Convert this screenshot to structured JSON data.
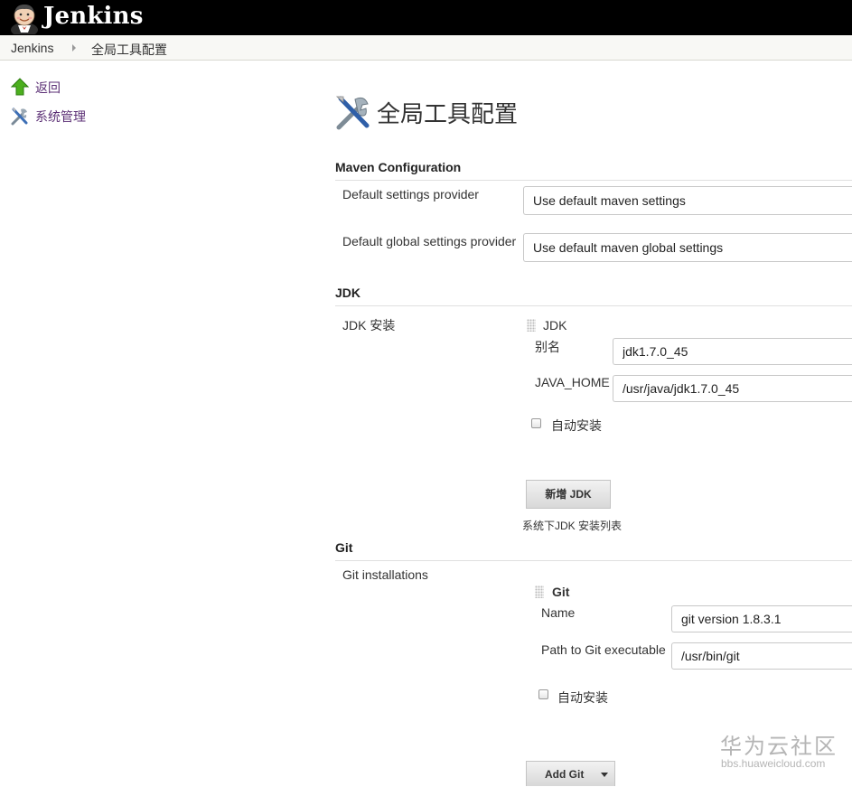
{
  "header": {
    "logo_text": "Jenkins"
  },
  "breadcrumb": {
    "items": [
      "Jenkins",
      "全局工具配置"
    ]
  },
  "side_panel": {
    "items": [
      {
        "label": "返回",
        "icon": "up-arrow-icon"
      },
      {
        "label": "系统管理",
        "icon": "tools-icon"
      }
    ]
  },
  "page": {
    "title": "全局工具配置"
  },
  "maven": {
    "section_title": "Maven Configuration",
    "settings_label": "Default settings provider",
    "settings_value": "Use default maven settings",
    "global_label": "Default global settings provider",
    "global_value": "Use default maven global settings"
  },
  "jdk": {
    "section_title": "JDK",
    "install_label": "JDK 安装",
    "block_title": "JDK",
    "alias_label": "别名",
    "alias_value": "jdk1.7.0_45",
    "home_label": "JAVA_HOME",
    "home_value": "/usr/java/jdk1.7.0_45",
    "auto_install_label": "自动安装",
    "add_button": "新增 JDK",
    "list_note": "系统下JDK 安装列表"
  },
  "git": {
    "section_title": "Git",
    "install_label": "Git installations",
    "block_title": "Git",
    "name_label": "Name",
    "name_value": "git version 1.8.3.1",
    "path_label": "Path to Git executable",
    "path_value": "/usr/bin/git",
    "auto_install_label": "自动安装",
    "add_button": "Add Git"
  },
  "watermark": {
    "brand": "华为云社区",
    "url": "bbs.huaweicloud.com"
  },
  "colors": {
    "header_bg": "#000000",
    "side_link": "#5b2f75",
    "breadcrumb_bg": "#f8f8f5"
  }
}
